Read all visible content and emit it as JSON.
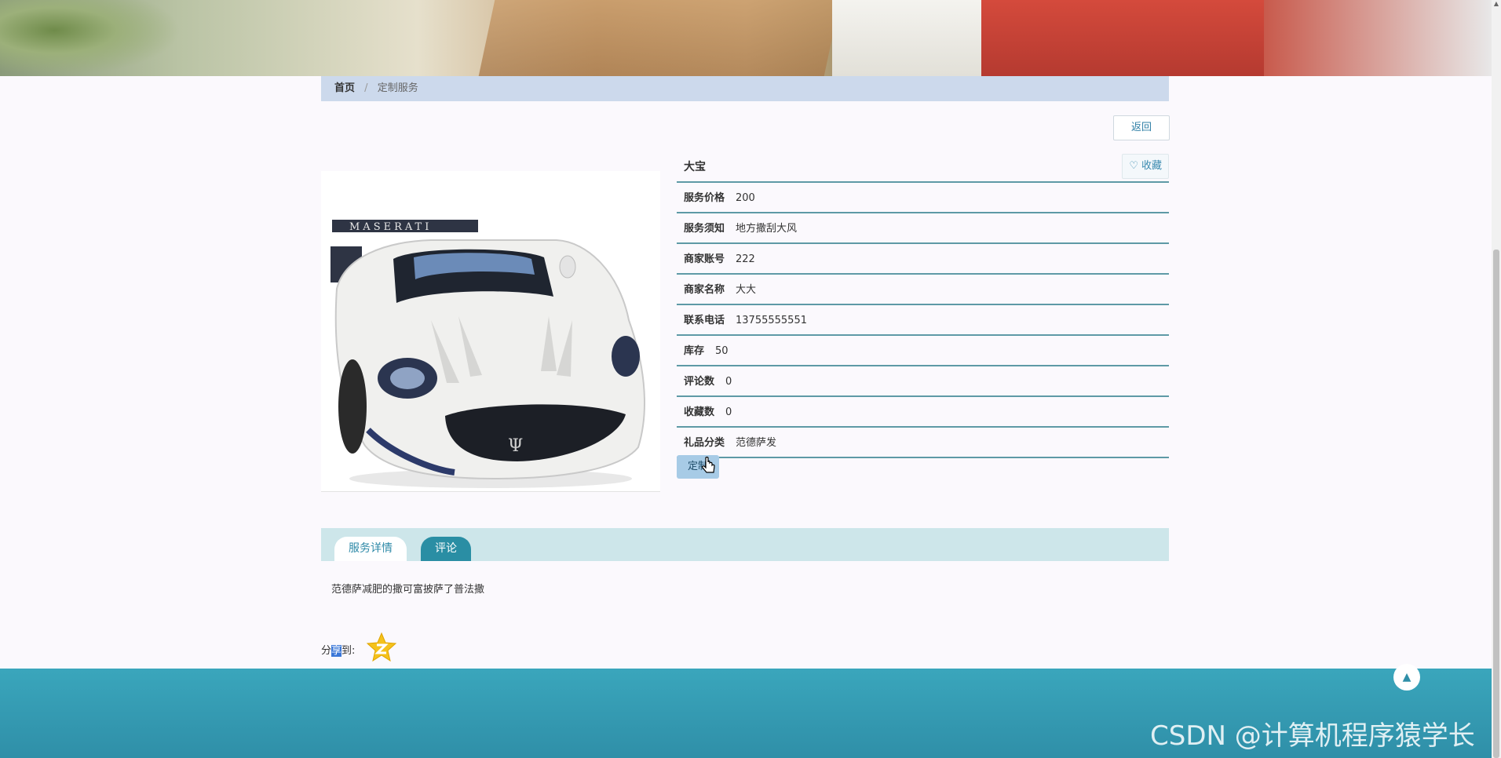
{
  "breadcrumb": {
    "home": "首页",
    "separator": "/",
    "current": "定制服务"
  },
  "actions": {
    "back_label": "返回",
    "favorite_label": "收藏",
    "order_label": "定制"
  },
  "product": {
    "name": "大宝",
    "fields": [
      {
        "label": "服务价格",
        "value": "200"
      },
      {
        "label": "服务须知",
        "value": "地方撒刮大风"
      },
      {
        "label": "商家账号",
        "value": "222"
      },
      {
        "label": "商家名称",
        "value": "大大"
      },
      {
        "label": "联系电话",
        "value": "13755555551"
      },
      {
        "label": "库存",
        "value": "50"
      },
      {
        "label": "评论数",
        "value": "0"
      },
      {
        "label": "收藏数",
        "value": "0"
      },
      {
        "label": "礼品分类",
        "value": "范德萨发"
      }
    ],
    "image_brand_text": "MASERATI"
  },
  "tabs": [
    {
      "label": "服务详情"
    },
    {
      "label": "评论"
    }
  ],
  "description": "范德萨减肥的撒可富披萨了普法撒",
  "share": {
    "prefix": "分",
    "highlight": "享",
    "suffix": "到:"
  },
  "watermark": "CSDN @计算机程序猿学长",
  "icons": [
    "heart-icon",
    "cursor-icon",
    "qzone-icon",
    "arrow-up-icon"
  ],
  "colors": {
    "accent": "#2a8ea4",
    "breadcrumb_bg": "#ccd9ec",
    "footer": "#3aa6bc"
  }
}
